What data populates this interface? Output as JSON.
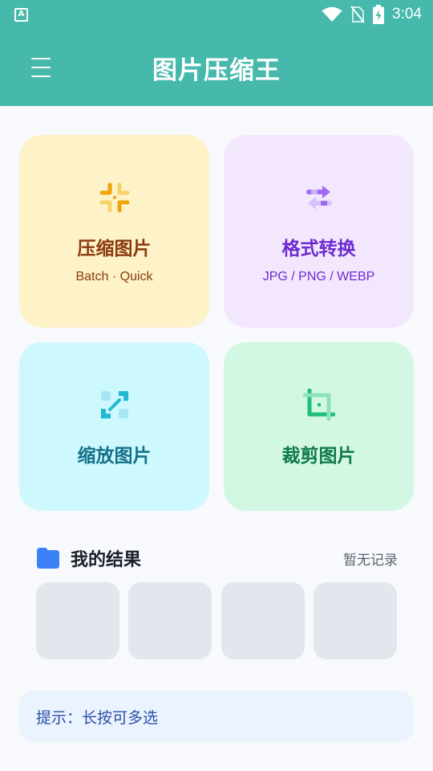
{
  "status_bar": {
    "app_icon_letter": "A",
    "time": "3:04"
  },
  "app_bar": {
    "title": "图片压缩王"
  },
  "cards": {
    "compress": {
      "title": "压缩图片",
      "subtitle": "Batch · Quick",
      "icon": "compress-icon",
      "color": "#f0a30a"
    },
    "convert": {
      "title": "格式转换",
      "subtitle": "JPG / PNG / WEBP",
      "icon": "convert-icon",
      "color": "#9b6cf0"
    },
    "resize": {
      "title": "缩放图片",
      "icon": "resize-icon",
      "color": "#22b8d4"
    },
    "crop": {
      "title": "裁剪图片",
      "icon": "crop-icon",
      "color": "#1fbf7a"
    }
  },
  "results": {
    "title": "我的结果",
    "empty_text": "暂无记录",
    "icon": "folder-icon",
    "thumbnail_count": 4
  },
  "tip": {
    "text": "提示：长按可多选"
  },
  "colors": {
    "primary": "#46b9ac",
    "folder": "#3b82f6"
  }
}
